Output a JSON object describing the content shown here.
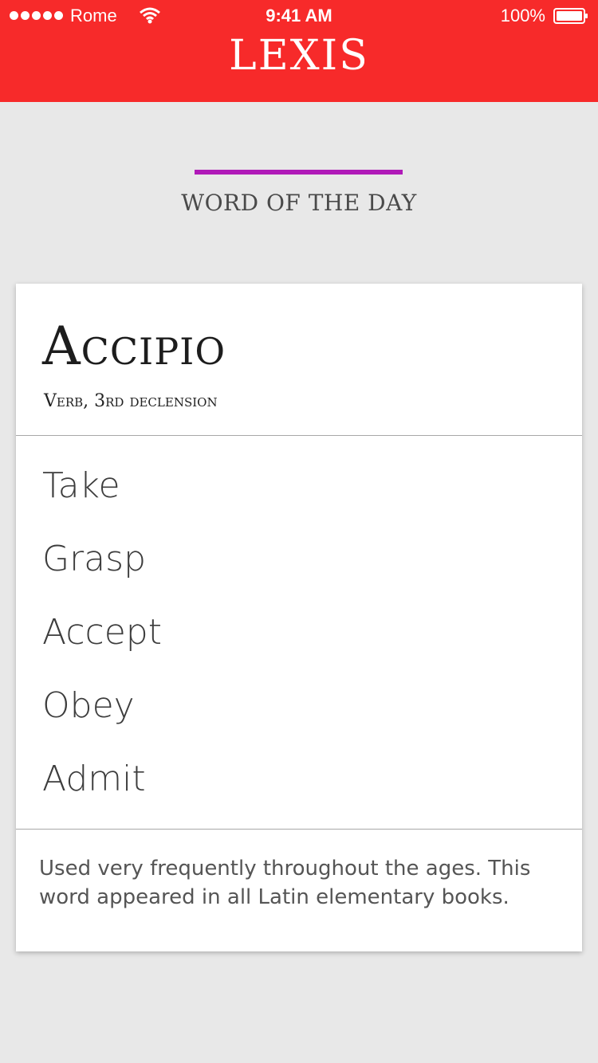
{
  "status_bar": {
    "carrier": "Rome",
    "time": "9:41 AM",
    "battery": "100%"
  },
  "app": {
    "title": "LEXIS"
  },
  "section": {
    "title": "WORD OF THE DAY"
  },
  "word": {
    "latin": "Accipio",
    "grammar": "Verb, 3rd declension",
    "meanings": [
      "Take",
      "Grasp",
      "Accept",
      "Obey",
      "Admit"
    ],
    "note": "Used very frequently throughout the ages. This word appeared in all Latin elementary books."
  },
  "colors": {
    "header": "#f72a2a",
    "accent": "#b01ab8",
    "background": "#e8e8e8"
  }
}
